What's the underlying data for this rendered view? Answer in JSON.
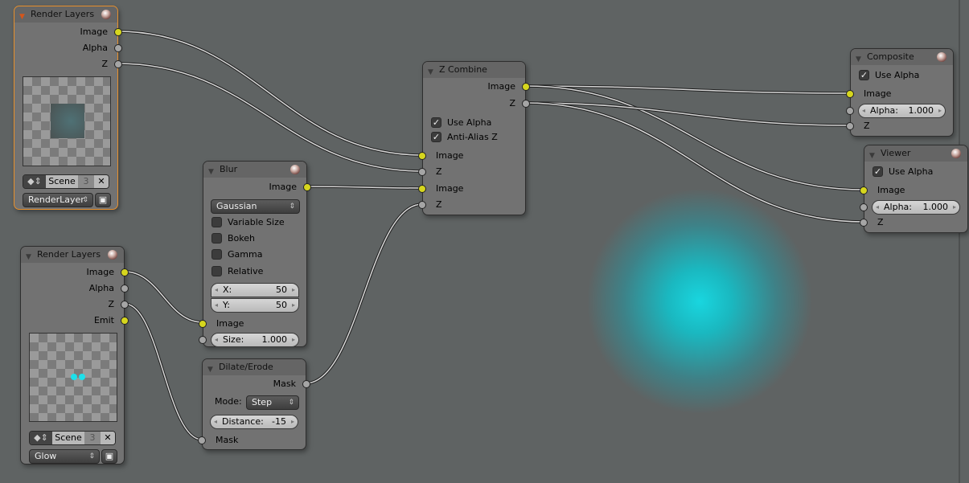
{
  "colors": {
    "selected_outline": "#e8902c",
    "image_socket": "#d6d61e",
    "value_socket": "#a5a5a5",
    "glow": "#19d6df"
  },
  "render_layers_1": {
    "title": "Render Layers",
    "outputs": [
      "Image",
      "Alpha",
      "Z"
    ],
    "scene": "Scene",
    "users": "3",
    "layer": "RenderLayer"
  },
  "render_layers_2": {
    "title": "Render Layers",
    "outputs": [
      "Image",
      "Alpha",
      "Z",
      "Emit"
    ],
    "scene": "Scene",
    "users": "3",
    "layer": "Glow"
  },
  "blur": {
    "title": "Blur",
    "output": "Image",
    "filter": "Gaussian",
    "options": [
      "Variable Size",
      "Bokeh",
      "Gamma",
      "Relative"
    ],
    "x_label": "X:",
    "x": "50",
    "y_label": "Y:",
    "y": "50",
    "input": "Image",
    "size_label": "Size:",
    "size": "1.000"
  },
  "dilate": {
    "title": "Dilate/Erode",
    "output": "Mask",
    "mode_label": "Mode:",
    "mode": "Step",
    "distance_label": "Distance:",
    "distance": "-15",
    "input": "Mask"
  },
  "zcombine": {
    "title": "Z Combine",
    "outputs": [
      "Image",
      "Z"
    ],
    "use_alpha": "Use Alpha",
    "anti_alias": "Anti-Alias Z",
    "inputs": [
      "Image",
      "Z",
      "Image",
      "Z"
    ]
  },
  "composite": {
    "title": "Composite",
    "use_alpha": "Use Alpha",
    "input_image": "Image",
    "alpha_label": "Alpha:",
    "alpha": "1.000",
    "input_z": "Z"
  },
  "viewer": {
    "title": "Viewer",
    "use_alpha": "Use Alpha",
    "input_image": "Image",
    "alpha_label": "Alpha:",
    "alpha": "1.000",
    "input_z": "Z"
  }
}
